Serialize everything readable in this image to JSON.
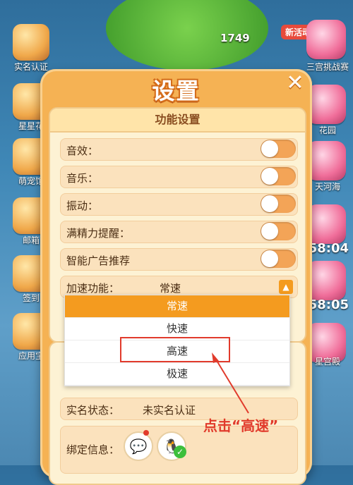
{
  "background": {
    "left_labels": [
      "实名认证",
      "星星花",
      "萌宠馆",
      "邮箱",
      "签到",
      "应用宝"
    ],
    "score": "1749",
    "new_activity": "新活动",
    "right_labels": [
      "三宫挑战赛",
      "花园",
      "天河海"
    ],
    "right_times": [
      "58:04",
      "58:05"
    ],
    "right_bottom_label": "星宫殿"
  },
  "dialog": {
    "title": "设置",
    "close_glyph": "✕",
    "function_section": {
      "header": "功能设置",
      "rows": [
        {
          "label": "音效：",
          "on": false
        },
        {
          "label": "音乐：",
          "on": false
        },
        {
          "label": "振动：",
          "on": false
        },
        {
          "label": "满精力提醒：",
          "on": false
        },
        {
          "label": "智能广告推荐",
          "on": false
        }
      ],
      "speed": {
        "label": "加速功能：",
        "value": "常速",
        "arrow_glyph": "▲"
      }
    },
    "account_section": {
      "realname_label": "实名状态：",
      "realname_value": "未实名认证",
      "bind_label": "绑定信息："
    }
  },
  "dropdown": {
    "options": [
      "常速",
      "快速",
      "高速",
      "极速"
    ],
    "selected": "常速"
  },
  "annotation": {
    "text": "点击“高速”",
    "color": "#e13b2c"
  },
  "colors": {
    "dialog_bg": "#f5b254",
    "accent": "#f49b1f",
    "toggle_off": "#f3a457"
  },
  "icons": [
    "close-icon",
    "dropdown-arrow-icon",
    "wechat-icon",
    "qq-icon",
    "check-icon"
  ]
}
